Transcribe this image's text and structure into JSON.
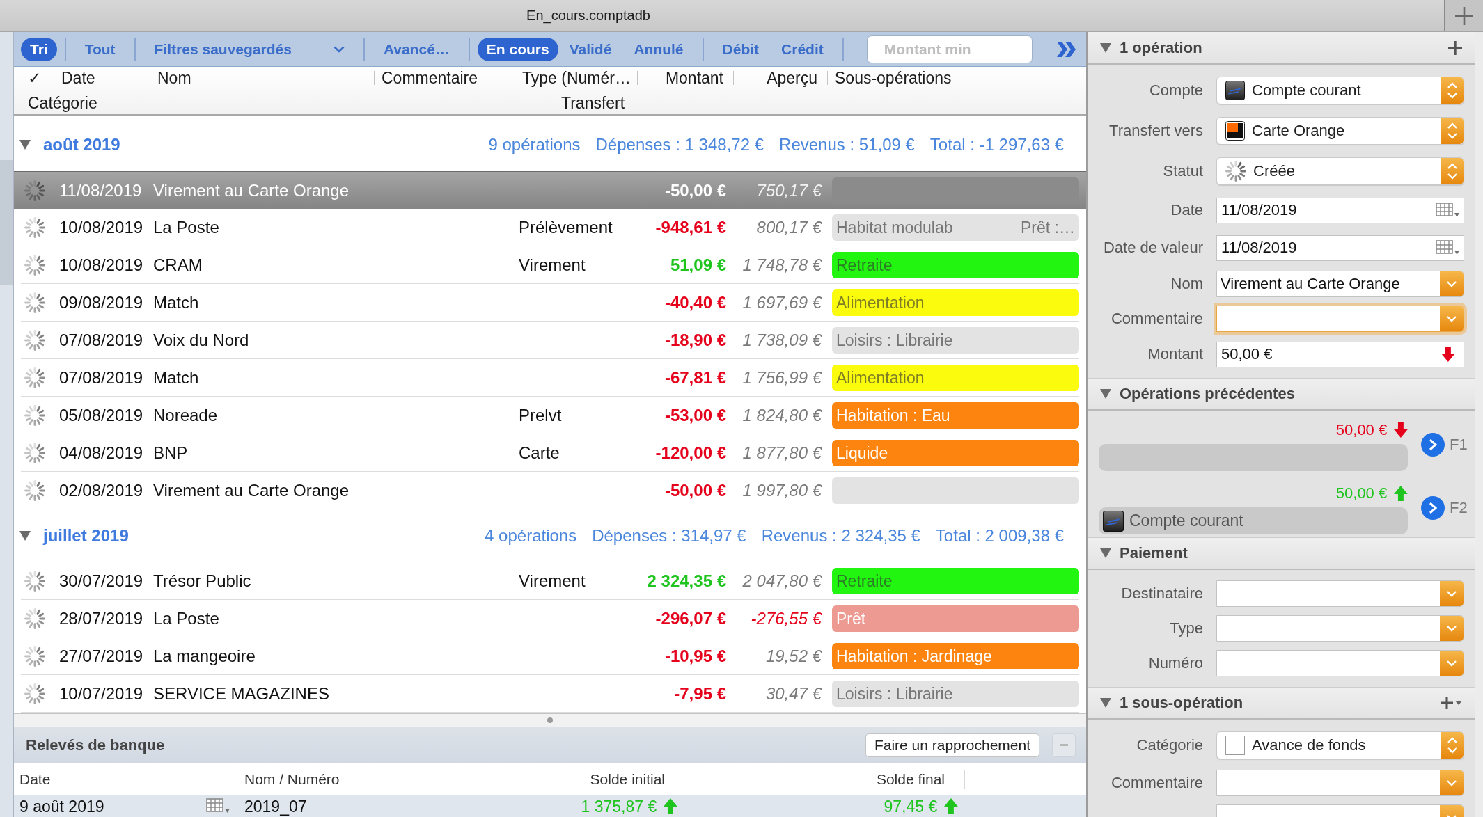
{
  "window": {
    "title": "En_cours.comptadb"
  },
  "toolbar": {
    "groups": [
      {
        "items": [
          {
            "label": "Tri",
            "kind": "toggle",
            "selected": true
          }
        ]
      },
      {
        "items": [
          {
            "label": "Tout",
            "kind": "toggle",
            "selected": false
          }
        ]
      },
      {
        "items": [
          {
            "label": "Filtres sauvegardés",
            "kind": "menu",
            "selected": false
          }
        ]
      },
      {
        "items": [
          {
            "label": "Avancé…",
            "kind": "toggle",
            "selected": false
          }
        ]
      },
      {
        "items": [
          {
            "label": "En cours",
            "kind": "toggle",
            "selected": true
          },
          {
            "label": "Validé",
            "kind": "toggle",
            "selected": false
          },
          {
            "label": "Annulé",
            "kind": "toggle",
            "selected": false
          }
        ]
      },
      {
        "items": [
          {
            "label": "Débit",
            "kind": "toggle",
            "selected": false
          },
          {
            "label": "Crédit",
            "kind": "toggle",
            "selected": false
          }
        ]
      }
    ],
    "search": {
      "placeholder": "Montant min"
    }
  },
  "columns": {
    "line_1": [
      "✓",
      "Date",
      "Nom",
      "Commentaire",
      "Type (Numér…",
      "Montant",
      "Aperçu",
      "Sous-opérations"
    ],
    "line_2": [
      "Catégorie",
      "Transfert"
    ]
  },
  "groups": [
    {
      "title": "août 2019",
      "expanded": true,
      "count": "9 opérations",
      "expenses": "Dépenses : 1 348,72 €",
      "income": "Revenus : 51,09 €",
      "total": "Total : -1 297,63 €",
      "rows": [
        {
          "date": "11/08/2019",
          "name": "Virement au Carte Orange",
          "amount": "-50,00 €",
          "amount_negative": true,
          "balance": "750,17 €",
          "balance_negative": false,
          "color": "#8b8b8b",
          "selected": true
        },
        {
          "date": "10/08/2019",
          "name": "La Poste",
          "type": "Prélèvement",
          "amount": "-948,61 €",
          "amount_negative": true,
          "balance": "800,17 €",
          "balance_negative": false,
          "categories": [
            "Habitat modulab",
            "Prêt :…"
          ],
          "color": "#e3e3e3",
          "selected": false
        },
        {
          "date": "10/08/2019",
          "name": "CRAM",
          "type": "Virement",
          "amount": "51,09 €",
          "amount_negative": false,
          "balance": "1 748,78 €",
          "balance_negative": false,
          "categories": [
            "Retraite"
          ],
          "color": "#22f510",
          "selected": false
        },
        {
          "date": "09/08/2019",
          "name": "Match",
          "amount": "-40,40 €",
          "amount_negative": true,
          "balance": "1 697,69 €",
          "balance_negative": false,
          "categories": [
            "Alimentation"
          ],
          "color": "#fbfb0e",
          "selected": false
        },
        {
          "date": "07/08/2019",
          "name": "Voix du Nord",
          "amount": "-18,90 €",
          "amount_negative": true,
          "balance": "1 738,09 €",
          "balance_negative": false,
          "categories": [
            "Loisirs : Librairie"
          ],
          "color": "#e3e3e3",
          "selected": false
        },
        {
          "date": "07/08/2019",
          "name": "Match",
          "amount": "-67,81 €",
          "amount_negative": true,
          "balance": "1 756,99 €",
          "balance_negative": false,
          "categories": [
            "Alimentation"
          ],
          "color": "#fbfb0e",
          "selected": false
        },
        {
          "date": "05/08/2019",
          "name": "Noreade",
          "type": "Prelvt",
          "amount": "-53,00 €",
          "amount_negative": true,
          "balance": "1 824,80 €",
          "balance_negative": false,
          "categories": [
            "Habitation : Eau"
          ],
          "color": "#fd850f",
          "selected": false
        },
        {
          "date": "04/08/2019",
          "name": "BNP",
          "type": "Carte",
          "amount": "-120,00 €",
          "amount_negative": true,
          "balance": "1 877,80 €",
          "balance_negative": false,
          "categories": [
            "Liquide"
          ],
          "color": "#fd850f",
          "selected": false
        },
        {
          "date": "02/08/2019",
          "name": "Virement au Carte Orange",
          "amount": "-50,00 €",
          "amount_negative": true,
          "balance": "1 997,80 €",
          "balance_negative": false,
          "color": "#e3e3e3",
          "selected": false
        }
      ]
    },
    {
      "title": "juillet 2019",
      "expanded": true,
      "count": "4 opérations",
      "expenses": "Dépenses : 314,97 €",
      "income": "Revenus : 2 324,35 €",
      "total": "Total : 2 009,38 €",
      "rows": [
        {
          "date": "30/07/2019",
          "name": "Trésor Public",
          "type": "Virement",
          "amount": "2 324,35 €",
          "amount_negative": false,
          "balance": "2 047,80 €",
          "balance_negative": false,
          "categories": [
            "Retraite"
          ],
          "color": "#22f510",
          "selected": false
        },
        {
          "date": "28/07/2019",
          "name": "La Poste",
          "amount": "-296,07 €",
          "amount_negative": true,
          "balance": "-276,55 €",
          "balance_negative": true,
          "categories": [
            "Prêt"
          ],
          "color": "#ed9a92",
          "selected": false
        },
        {
          "date": "27/07/2019",
          "name": "La mangeoire",
          "amount": "-10,95 €",
          "amount_negative": true,
          "balance": "19,52 €",
          "balance_negative": false,
          "categories": [
            "Habitation : Jardinage"
          ],
          "color": "#fd850f",
          "selected": false
        },
        {
          "date": "10/07/2019",
          "name": "SERVICE MAGAZINES",
          "amount": "-7,95 €",
          "amount_negative": true,
          "balance": "30,47 €",
          "balance_negative": false,
          "categories": [
            "Loisirs : Librairie"
          ],
          "color": "#e3e3e3",
          "selected": false
        }
      ]
    }
  ],
  "statements": {
    "title": "Relevés de banque",
    "reconcile_button": "Faire un rapprochement",
    "remove_disabled": true,
    "columns": [
      "Date",
      "Nom / Numéro",
      "Solde initial",
      "Solde final"
    ],
    "rows": [
      {
        "date": "9 août 2019",
        "name": "2019_07",
        "initial_balance": "1 375,87 €",
        "initial_up": true,
        "final_balance": "97,45 €",
        "final_up": true,
        "selected": true
      }
    ]
  },
  "operation": {
    "title": "1 opération",
    "expanded": true,
    "add_button": true,
    "add_menu": false,
    "fields": [
      {
        "label": "Compte",
        "kind": "account",
        "value": "Compte courant",
        "focused": false
      },
      {
        "label": "Transfert vers",
        "kind": "transfer",
        "value": "Carte Orange",
        "focused": false
      },
      {
        "label": "Statut",
        "kind": "status",
        "value": "Créée",
        "focused": false
      },
      {
        "label": "Date",
        "kind": "date",
        "value": "11/08/2019",
        "focused": false
      },
      {
        "label": "Date de valeur",
        "kind": "date",
        "value": "11/08/2019",
        "focused": false
      },
      {
        "label": "Nom",
        "kind": "combo",
        "value": "Virement au Carte Orange",
        "focused": false
      },
      {
        "label": "Commentaire",
        "kind": "combo",
        "focused": true
      },
      {
        "label": "Montant",
        "kind": "amount",
        "value": "50,00 €",
        "outgoing": true,
        "focused": false
      }
    ]
  },
  "previous_operations": {
    "title": "Opérations précédentes",
    "expanded": true,
    "add_button": false,
    "items": [
      {
        "amount": "50,00 €",
        "outgoing": true,
        "shortcut": "F1"
      },
      {
        "amount": "50,00 €",
        "outgoing": false,
        "account": "Compte courant",
        "shortcut": "F2"
      }
    ]
  },
  "payment": {
    "title": "Paiement",
    "expanded": true,
    "add_button": false,
    "fields": [
      {
        "label": "Destinataire",
        "kind": "combo",
        "focused": false
      },
      {
        "label": "Type",
        "kind": "combo",
        "focused": false
      },
      {
        "label": "Numéro",
        "kind": "combo",
        "focused": false
      }
    ]
  },
  "sub_operations": {
    "title": "1 sous-opération",
    "expanded": true,
    "add_button": true,
    "add_menu": true,
    "fields": [
      {
        "label": "Catégorie",
        "kind": "category",
        "color": "#ffffff",
        "value": "Avance de fonds",
        "focused": false
      },
      {
        "label": "Commentaire",
        "kind": "combo",
        "focused": false
      },
      {
        "kind": "combo",
        "focused": false
      }
    ]
  }
}
